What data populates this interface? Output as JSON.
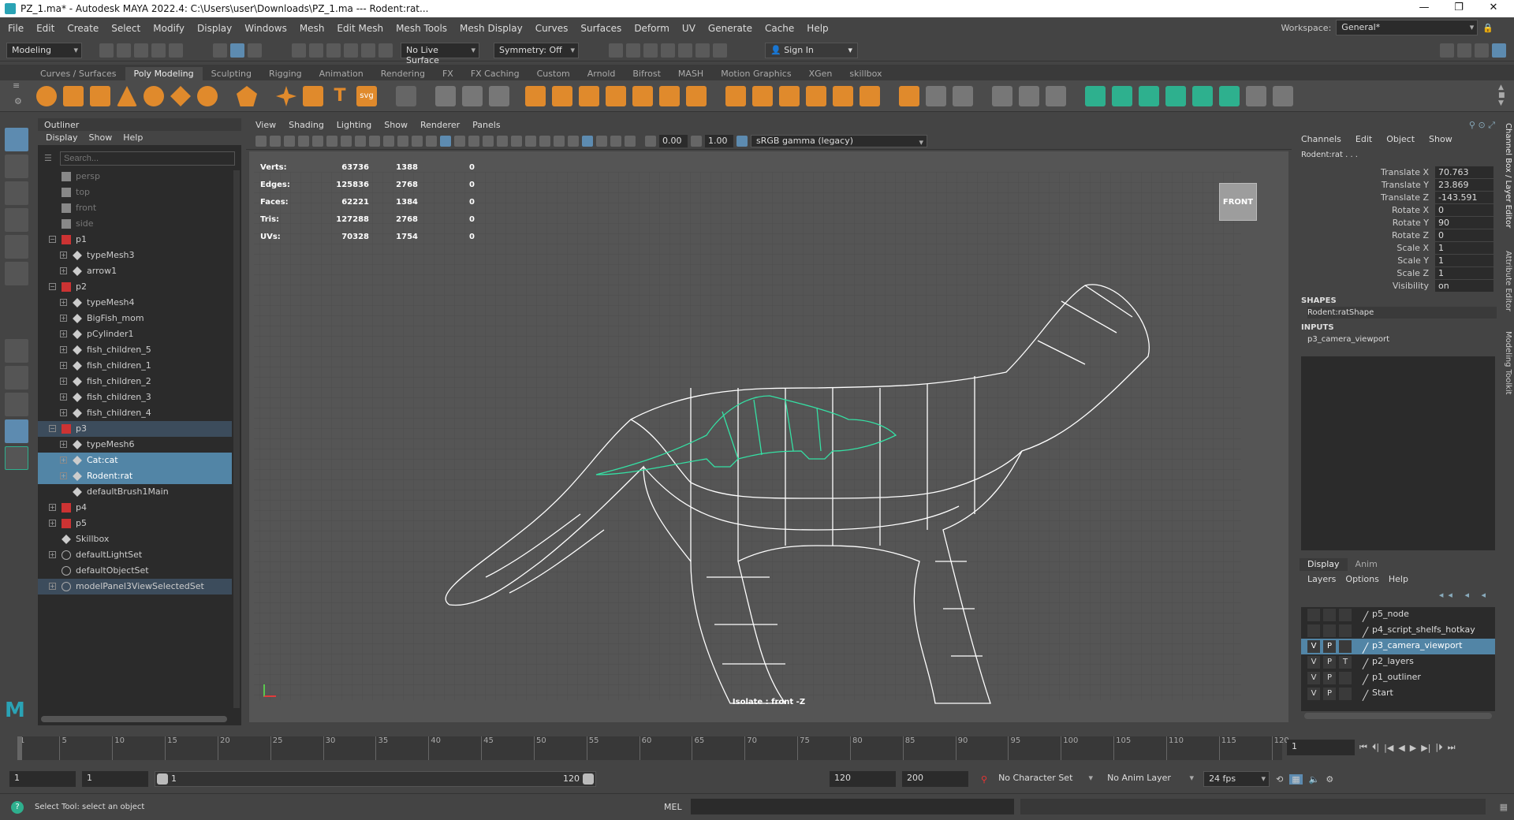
{
  "title": "PZ_1.ma* - Autodesk MAYA 2022.4: C:\\Users\\user\\Downloads\\PZ_1.ma   ---   Rodent:rat...",
  "window_controls": {
    "minimize": "—",
    "maximize": "❐",
    "close": "✕"
  },
  "menu": [
    "File",
    "Edit",
    "Create",
    "Select",
    "Modify",
    "Display",
    "Windows",
    "Mesh",
    "Edit Mesh",
    "Mesh Tools",
    "Mesh Display",
    "Curves",
    "Surfaces",
    "Deform",
    "UV",
    "Generate",
    "Cache",
    "Help"
  ],
  "workspace": {
    "label": "Workspace:",
    "value": "General*"
  },
  "status": {
    "mode": "Modeling",
    "live_surface": "No Live Surface",
    "symmetry": "Symmetry: Off",
    "sign_in": "Sign In"
  },
  "shelf_tabs": [
    "Curves / Surfaces",
    "Poly Modeling",
    "Sculpting",
    "Rigging",
    "Animation",
    "Rendering",
    "FX",
    "FX Caching",
    "Custom",
    "Arnold",
    "Bifrost",
    "MASH",
    "Motion Graphics",
    "XGen",
    "skillbox"
  ],
  "shelf_active": "Poly Modeling",
  "shelf_icons": {
    "text_tool": "T",
    "svg_tool": "svg"
  },
  "outliner": {
    "title": "Outliner",
    "menu": [
      "Display",
      "Show",
      "Help"
    ],
    "search_placeholder": "Search...",
    "items": [
      {
        "label": "persp",
        "indent": 0,
        "type": "camera",
        "dim": true
      },
      {
        "label": "top",
        "indent": 0,
        "type": "camera",
        "dim": true
      },
      {
        "label": "front",
        "indent": 0,
        "type": "camera",
        "dim": true
      },
      {
        "label": "side",
        "indent": 0,
        "type": "camera",
        "dim": true
      },
      {
        "label": "p1",
        "indent": 0,
        "type": "group",
        "toggle": "−"
      },
      {
        "label": "typeMesh3",
        "indent": 1,
        "type": "mesh",
        "toggle": "+"
      },
      {
        "label": "arrow1",
        "indent": 1,
        "type": "mesh",
        "toggle": "+"
      },
      {
        "label": "p2",
        "indent": 0,
        "type": "group",
        "toggle": "−"
      },
      {
        "label": "typeMesh4",
        "indent": 1,
        "type": "mesh",
        "toggle": "+"
      },
      {
        "label": "BigFish_mom",
        "indent": 1,
        "type": "mesh",
        "toggle": "+"
      },
      {
        "label": "pCylinder1",
        "indent": 1,
        "type": "mesh",
        "toggle": "+"
      },
      {
        "label": "fish_children_5",
        "indent": 1,
        "type": "mesh",
        "toggle": "+"
      },
      {
        "label": "fish_children_1",
        "indent": 1,
        "type": "mesh",
        "toggle": "+"
      },
      {
        "label": "fish_children_2",
        "indent": 1,
        "type": "mesh",
        "toggle": "+"
      },
      {
        "label": "fish_children_3",
        "indent": 1,
        "type": "mesh",
        "toggle": "+"
      },
      {
        "label": "fish_children_4",
        "indent": 1,
        "type": "mesh",
        "toggle": "+"
      },
      {
        "label": "p3",
        "indent": 0,
        "type": "group",
        "toggle": "−",
        "state": "hl"
      },
      {
        "label": "typeMesh6",
        "indent": 1,
        "type": "mesh",
        "toggle": "+"
      },
      {
        "label": "Cat:cat",
        "indent": 1,
        "type": "mesh",
        "toggle": "+",
        "state": "sel"
      },
      {
        "label": "Rodent:rat",
        "indent": 1,
        "type": "mesh",
        "toggle": "+",
        "state": "sel"
      },
      {
        "label": "defaultBrush1Main",
        "indent": 1,
        "type": "mesh",
        "toggle": ""
      },
      {
        "label": "p4",
        "indent": 0,
        "type": "group",
        "toggle": "+"
      },
      {
        "label": "p5",
        "indent": 0,
        "type": "group",
        "toggle": "+"
      },
      {
        "label": "Skillbox",
        "indent": 0,
        "type": "mesh",
        "toggle": ""
      },
      {
        "label": "defaultLightSet",
        "indent": 0,
        "type": "set",
        "toggle": "+"
      },
      {
        "label": "defaultObjectSet",
        "indent": 0,
        "type": "set",
        "toggle": ""
      },
      {
        "label": "modelPanel3ViewSelectedSet",
        "indent": 0,
        "type": "set",
        "toggle": "+",
        "state": "hl"
      }
    ]
  },
  "viewport": {
    "menu": [
      "View",
      "Shading",
      "Lighting",
      "Show",
      "Renderer",
      "Panels"
    ],
    "exposure": "0.00",
    "gamma": "1.00",
    "colorspace": "sRGB gamma (legacy)",
    "hud": [
      {
        "label": "Verts:",
        "a": "63736",
        "b": "1388",
        "c": "0"
      },
      {
        "label": "Edges:",
        "a": "125836",
        "b": "2768",
        "c": "0"
      },
      {
        "label": "Faces:",
        "a": "62221",
        "b": "1384",
        "c": "0"
      },
      {
        "label": "Tris:",
        "a": "127288",
        "b": "2768",
        "c": "0"
      },
      {
        "label": "UVs:",
        "a": "70328",
        "b": "1754",
        "c": "0"
      }
    ],
    "camera_label": "FRONT",
    "isolate": "Isolate : front -Z"
  },
  "channel_box": {
    "menu": [
      "Channels",
      "Edit",
      "Object",
      "Show"
    ],
    "object": "Rodent:rat . . .",
    "attrs": [
      {
        "label": "Translate X",
        "value": "70.763"
      },
      {
        "label": "Translate Y",
        "value": "23.869"
      },
      {
        "label": "Translate Z",
        "value": "-143.591"
      },
      {
        "label": "Rotate X",
        "value": "0"
      },
      {
        "label": "Rotate Y",
        "value": "90"
      },
      {
        "label": "Rotate Z",
        "value": "0"
      },
      {
        "label": "Scale X",
        "value": "1"
      },
      {
        "label": "Scale Y",
        "value": "1"
      },
      {
        "label": "Scale Z",
        "value": "1"
      },
      {
        "label": "Visibility",
        "value": "on"
      }
    ],
    "shapes_header": "SHAPES",
    "shape": "Rodent:ratShape",
    "inputs_header": "INPUTS",
    "input": "p3_camera_viewport"
  },
  "side_tabs": [
    "Channel Box / Layer Editor",
    "Attribute Editor",
    "Modeling Toolkit"
  ],
  "layer_editor": {
    "tabs": [
      "Display",
      "Anim"
    ],
    "menu": [
      "Layers",
      "Options",
      "Help"
    ],
    "layers": [
      {
        "name": "p5_node",
        "v": "",
        "p": "",
        "t": ""
      },
      {
        "name": "p4_script_shelfs_hotkay",
        "v": "",
        "p": "",
        "t": ""
      },
      {
        "name": "p3_camera_viewport",
        "v": "V",
        "p": "P",
        "t": "",
        "sel": true
      },
      {
        "name": "p2_layers",
        "v": "V",
        "p": "P",
        "t": "T"
      },
      {
        "name": "p1_outliner",
        "v": "V",
        "p": "P",
        "t": ""
      },
      {
        "name": "Start",
        "v": "V",
        "p": "P",
        "t": ""
      }
    ]
  },
  "timeline": {
    "ticks": [
      "1",
      "5",
      "10",
      "15",
      "20",
      "25",
      "30",
      "35",
      "40",
      "45",
      "50",
      "55",
      "60",
      "65",
      "70",
      "75",
      "80",
      "85",
      "90",
      "95",
      "100",
      "105",
      "110",
      "115",
      "120"
    ],
    "current": "1"
  },
  "range": {
    "start": "1",
    "anim_start": "1",
    "slider_start": "1",
    "slider_end": "120",
    "end": "120",
    "anim_end": "200",
    "character_set": "No Character Set",
    "anim_layer": "No Anim Layer",
    "fps": "24 fps"
  },
  "command": {
    "status": "Select Tool: select an object",
    "lang": "MEL"
  },
  "colors": {
    "selection": "#5285a6",
    "rat_wire": "#35e0a4",
    "cat_wire": "#ffffff",
    "viewport_bg": "#555555"
  }
}
